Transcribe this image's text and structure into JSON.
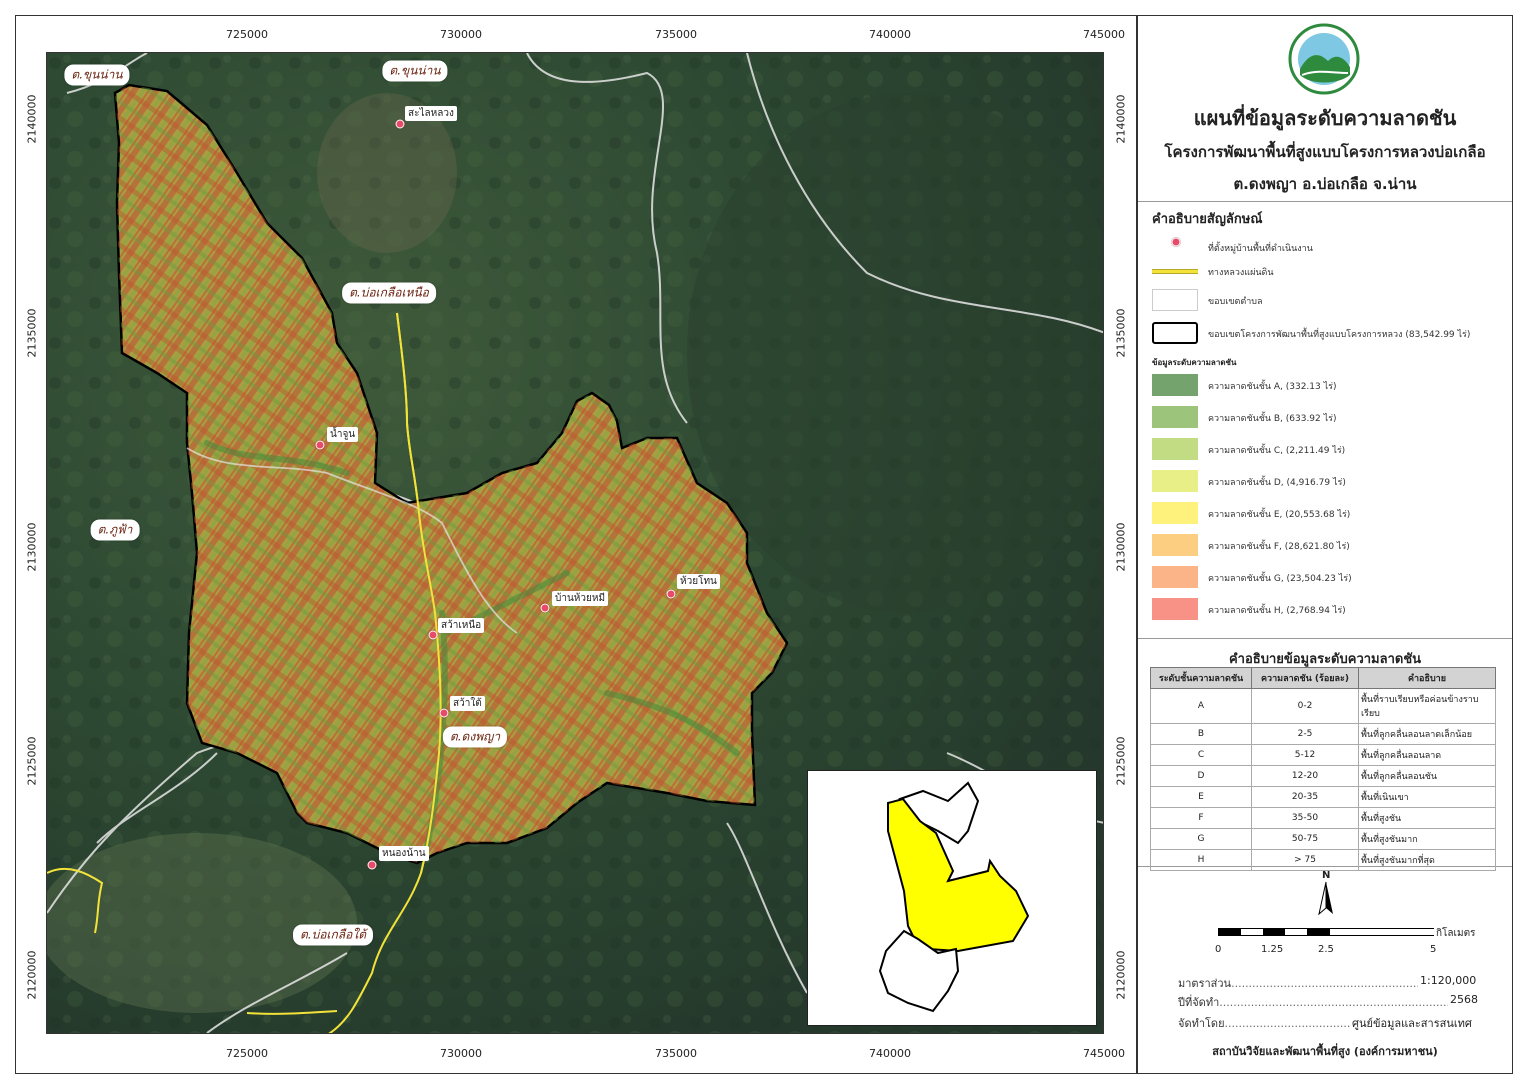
{
  "map": {
    "coords_top": [
      "725000",
      "730000",
      "735000",
      "740000",
      "745000"
    ],
    "coords_bottom": [
      "725000",
      "730000",
      "735000",
      "740000",
      "745000"
    ],
    "coords_left": [
      "2140000",
      "2135000",
      "2130000",
      "2125000",
      "2120000"
    ],
    "coords_right": [
      "2140000",
      "2135000",
      "2130000",
      "2125000",
      "2120000"
    ],
    "place_labels": [
      "ต.ขุนน่าน",
      "ต.ขุนน่าน",
      "ต.บ่อเกลือเหนือ",
      "ต.ภูฟ้า",
      "ต.ดงพญา",
      "ต.บ่อเกลือใต้"
    ],
    "villages": [
      "สะไลหลวง",
      "น้ำจูน",
      "บ้านห้วยหมี",
      "ห้วยโทน",
      "สว้าเหนือ",
      "สว้าใต้",
      "หนองน้าน"
    ]
  },
  "header": {
    "title": "แผนที่ข้อมูลระดับความลาดชัน",
    "subtitle": "โครงการพัฒนาพื้นที่สูงแบบโครงการหลวงบ่อเกลือ",
    "location": "ต.ดงพญา อ.บ่อเกลือ จ.น่าน"
  },
  "legend": {
    "title": "คำอธิบายสัญลักษณ์",
    "village": "ที่ตั้งหมู่บ้านพื้นที่ดำเนินงาน",
    "road": "ทางหลวงแผ่นดิน",
    "subdistrict": "ขอบเขตตำบล",
    "project": "ขอบเขตโครงการพัฒนาพื้นที่สูงแบบโครงการหลวง (83,542.99 ไร่)",
    "slope_heading": "ข้อมูลระดับความลาดชัน",
    "slope_classes": [
      {
        "label": "ความลาดชันชั้น  A, (332.13 ไร่)",
        "color": "#74a36e"
      },
      {
        "label": "ความลาดชันชั้น  B, (633.92 ไร่)",
        "color": "#9cc47a"
      },
      {
        "label": "ความลาดชันชั้น  C, (2,211.49 ไร่)",
        "color": "#c2dc84"
      },
      {
        "label": "ความลาดชันชั้น  D, (4,916.79 ไร่)",
        "color": "#e8ef86"
      },
      {
        "label": "ความลาดชันชั้น  E, (20,553.68 ไร่)",
        "color": "#fff27c"
      },
      {
        "label": "ความลาดชันชั้น  F, (28,621.80 ไร่)",
        "color": "#fcce82"
      },
      {
        "label": "ความลาดชันชั้น  G, (23,504.23 ไร่)",
        "color": "#fbb388"
      },
      {
        "label": "ความลาดชันชั้น  H, (2,768.94 ไร่)",
        "color": "#f99286"
      }
    ]
  },
  "table": {
    "title": "คำอธิบายข้อมูลระดับความลาดชัน",
    "headers": [
      "ระดับชั้นความลาดชัน",
      "ความลาดชัน (ร้อยละ)",
      "คำอธิบาย"
    ],
    "rows": [
      [
        "A",
        "0-2",
        "พื้นที่ราบเรียบหรือค่อนข้างราบเรียบ"
      ],
      [
        "B",
        "2-5",
        "พื้นที่ลูกคลื่นลอนลาดเล็กน้อย"
      ],
      [
        "C",
        "5-12",
        "พื้นที่ลูกคลื่นลอนลาด"
      ],
      [
        "D",
        "12-20",
        "พื้นที่ลูกคลื่นลอนชัน"
      ],
      [
        "E",
        "20-35",
        "พื้นที่เนินเขา"
      ],
      [
        "F",
        "35-50",
        "พื้นที่สูงชัน"
      ],
      [
        "G",
        "50-75",
        "พื้นที่สูงชันมาก"
      ],
      [
        "H",
        "> 75",
        "พื้นที่สูงชันมากที่สุด"
      ]
    ]
  },
  "scale": {
    "north": "N",
    "unit": "กิโลเมตร",
    "ticks": [
      "0",
      "1.25",
      "2.5",
      "5"
    ]
  },
  "meta": {
    "scale_label": "มาตราส่วน",
    "scale_value": "1:120,000",
    "year_label": "ปีที่จัดทำ",
    "year_value": "2568",
    "by_label": "จัดทำโดย",
    "by_value": "ศูนย์ข้อมูลและสารสนเทศ",
    "institute": "สถาบันวิจัยและพัฒนาพื้นที่สูง (องค์การมหาชน)"
  },
  "colors": {
    "project_boundary": "#000000",
    "subdistrict_boundary": "#e6e6e6",
    "road": "#f2e23a",
    "inset_fill": "#ffff00"
  }
}
